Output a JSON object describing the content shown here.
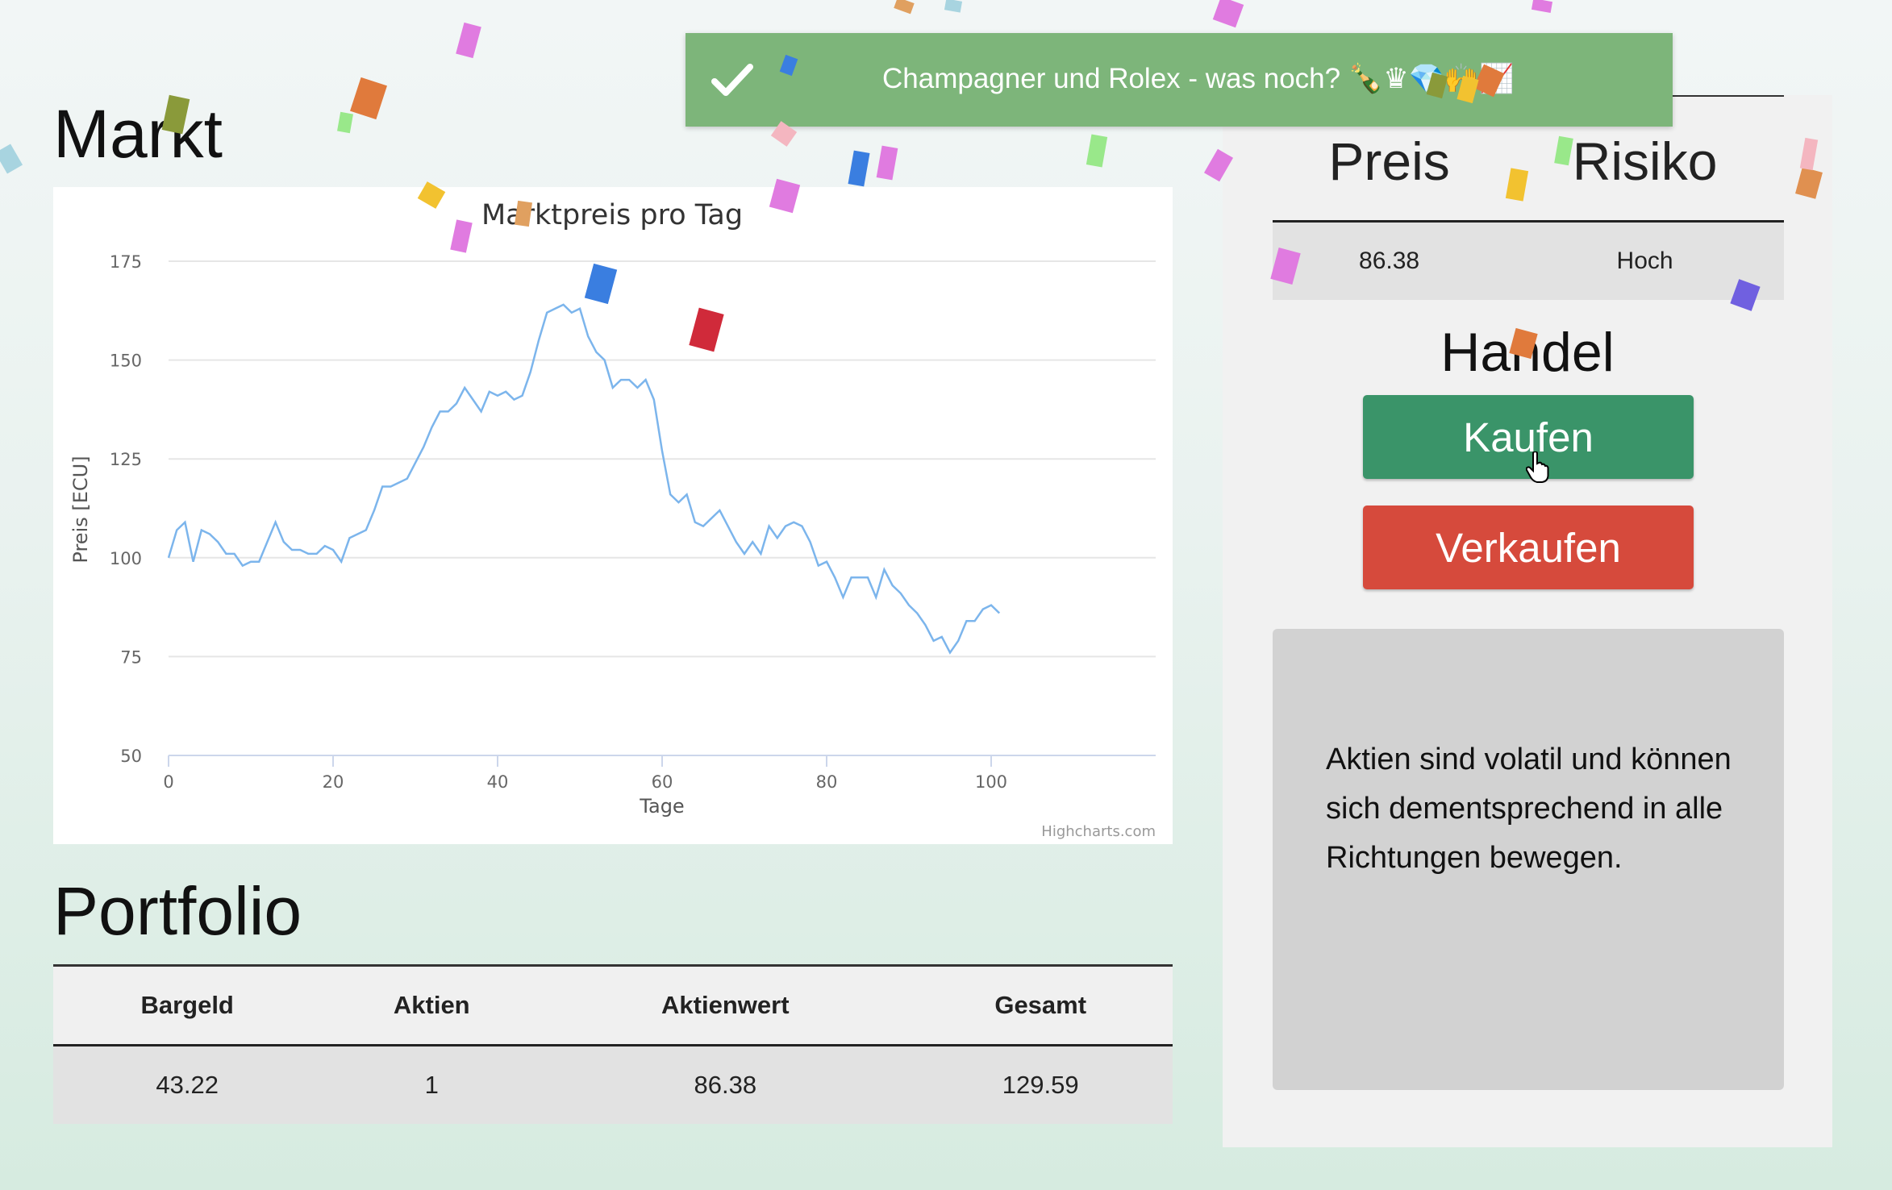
{
  "markt": {
    "title": "Markt"
  },
  "chart_data": {
    "type": "line",
    "title": "Marktpreis pro Tag",
    "xlabel": "Tage",
    "ylabel": "Preis [ECU]",
    "xlim": [
      0,
      120
    ],
    "ylim": [
      50,
      175
    ],
    "xticks": [
      0,
      20,
      40,
      60,
      80,
      100
    ],
    "yticks": [
      50,
      75,
      100,
      125,
      150,
      175
    ],
    "grid": true,
    "credit": "Highcharts.com",
    "color": "#7cb5ec",
    "series": [
      {
        "x": [
          0,
          1,
          2,
          3,
          4,
          5,
          6,
          7,
          8,
          9,
          10,
          11,
          12,
          13,
          14,
          15,
          16,
          17,
          18,
          19,
          20,
          21,
          22,
          23,
          24,
          25,
          26,
          27,
          28,
          29,
          30,
          31,
          32,
          33,
          34,
          35,
          36,
          37,
          38,
          39,
          40,
          41,
          42,
          43,
          44,
          45,
          46,
          47,
          48,
          49,
          50,
          51,
          52,
          53,
          54,
          55,
          56,
          57,
          58,
          59,
          60,
          61,
          62,
          63,
          64,
          65,
          66,
          67,
          68,
          69,
          70,
          71,
          72,
          73,
          74,
          75,
          76,
          77,
          78,
          79,
          80,
          81,
          82,
          83,
          84,
          85,
          86,
          87,
          88,
          89,
          90,
          91,
          92,
          93,
          94,
          95,
          96,
          97,
          98,
          99,
          100,
          101
        ],
        "y": [
          100,
          107,
          109,
          99,
          107,
          106,
          104,
          101,
          101,
          98,
          99,
          99,
          104,
          109,
          104,
          102,
          102,
          101,
          101,
          103,
          102,
          99,
          105,
          106,
          107,
          112,
          118,
          118,
          119,
          120,
          124,
          128,
          133,
          137,
          137,
          139,
          143,
          140,
          137,
          142,
          141,
          142,
          140,
          141,
          147,
          155,
          162,
          163,
          164,
          162,
          163,
          156,
          152,
          150,
          143,
          145,
          145,
          143,
          145,
          140,
          127,
          116,
          114,
          116,
          109,
          108,
          110,
          112,
          108,
          104,
          101,
          104,
          101,
          108,
          105,
          108,
          109,
          108,
          104,
          98,
          99,
          95,
          90,
          95,
          95,
          95,
          90,
          97,
          93,
          91,
          88,
          86,
          83,
          79,
          80,
          76,
          79,
          84,
          84,
          87,
          88,
          86
        ]
      }
    ]
  },
  "portfolio": {
    "title": "Portfolio",
    "headers": [
      "Bargeld",
      "Aktien",
      "Aktienwert",
      "Gesamt"
    ],
    "values": [
      "43.22",
      "1",
      "86.38",
      "129.59"
    ]
  },
  "side": {
    "headers": [
      "Preis",
      "Risiko"
    ],
    "values": [
      "86.38",
      "Hoch"
    ],
    "handel_title": "Handel",
    "buy_label": "Kaufen",
    "sell_label": "Verkaufen",
    "info_text": "Aktien sind volatil und können sich dementsprechend in alle Richtungen bewegen.",
    "buy_color": "#3a9469",
    "sell_color": "#d64a3c"
  },
  "toast": {
    "text": "Champagner und Rolex - was noch? 🍾♛💎🙌📈",
    "icon": "checkmark-icon",
    "color": "#7db57a"
  }
}
